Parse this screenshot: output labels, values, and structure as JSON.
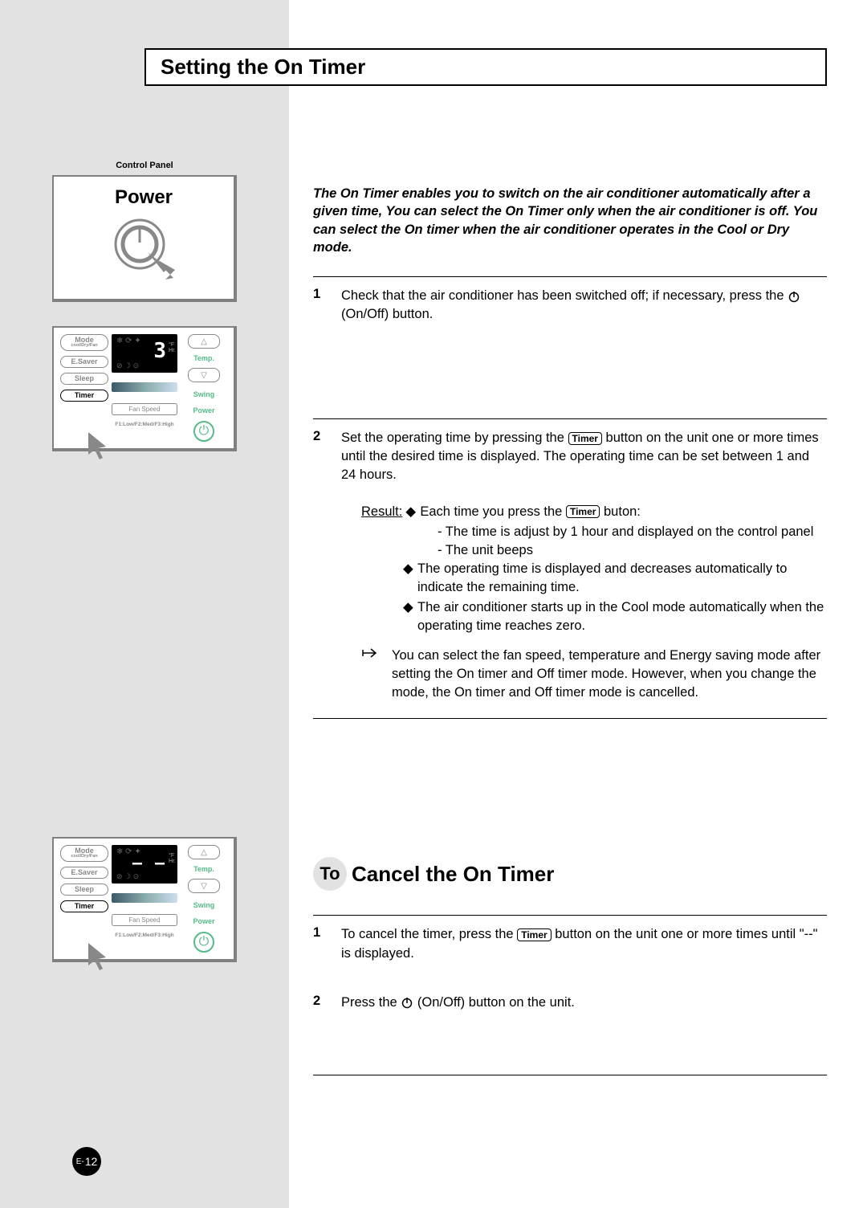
{
  "title": "Setting the On Timer",
  "sidebar": {
    "control_panel_label": "Control Panel",
    "power_label": "Power",
    "remote": {
      "mode": "Mode",
      "mode_sub": "cool/Dry/Fan",
      "esaver": "E.Saver",
      "sleep": "Sleep",
      "timer": "Timer",
      "fan_speed": "Fan Speed",
      "fan_caption": "F1:Low/F2:Med/F3:High",
      "temp": "Temp.",
      "swing": "Swing",
      "power": "Power",
      "display_num_a": "3",
      "display_num_b": "– –",
      "display_unit_f": "°F",
      "display_unit_hr": "Hr."
    }
  },
  "intro": "The On Timer enables you to switch on the air conditioner automatically after a given time, You can select the On Timer only when the air conditioner is off. You can select the On timer when the air conditioner operates in the Cool or Dry mode.",
  "steps": {
    "s1n": "1",
    "s1a": "Check that the air conditioner has been switched off; if necessary, press the ",
    "s1b": " (On/Off) button.",
    "s2n": "2",
    "s2a": "Set the operating time by pressing the ",
    "s2b": " button on the unit one or more times until the desired time is displayed. The operating time can be set between 1 and 24 hours.",
    "result_label": "Result:",
    "r1a": "Each time you press the ",
    "r1b": " buton:",
    "r1c": "- The time is adjust by 1 hour and displayed on the control panel",
    "r1d": "- The unit beeps",
    "r2": "The operating time is displayed and decreases automatically to indicate the remaining time.",
    "r3": "The air conditioner starts up in the Cool mode automatically when the operating time reaches zero.",
    "note": "You can select the fan speed, temperature and Energy saving mode after setting the On timer and Off timer mode. However, when you change the mode, the On timer and Off timer mode is cancelled."
  },
  "section2": {
    "to": "To",
    "title": " Cancel the On Timer",
    "c1n": "1",
    "c1a": "To cancel the timer, press the ",
    "c1b": " button on the unit one or more times until \"--\" is displayed.",
    "c2n": "2",
    "c2a": "Press the ",
    "c2b": " (On/Off) button on the unit."
  },
  "inline": {
    "timer_btn": "Timer"
  },
  "page_num_prefix": "E-",
  "page_num": "12"
}
